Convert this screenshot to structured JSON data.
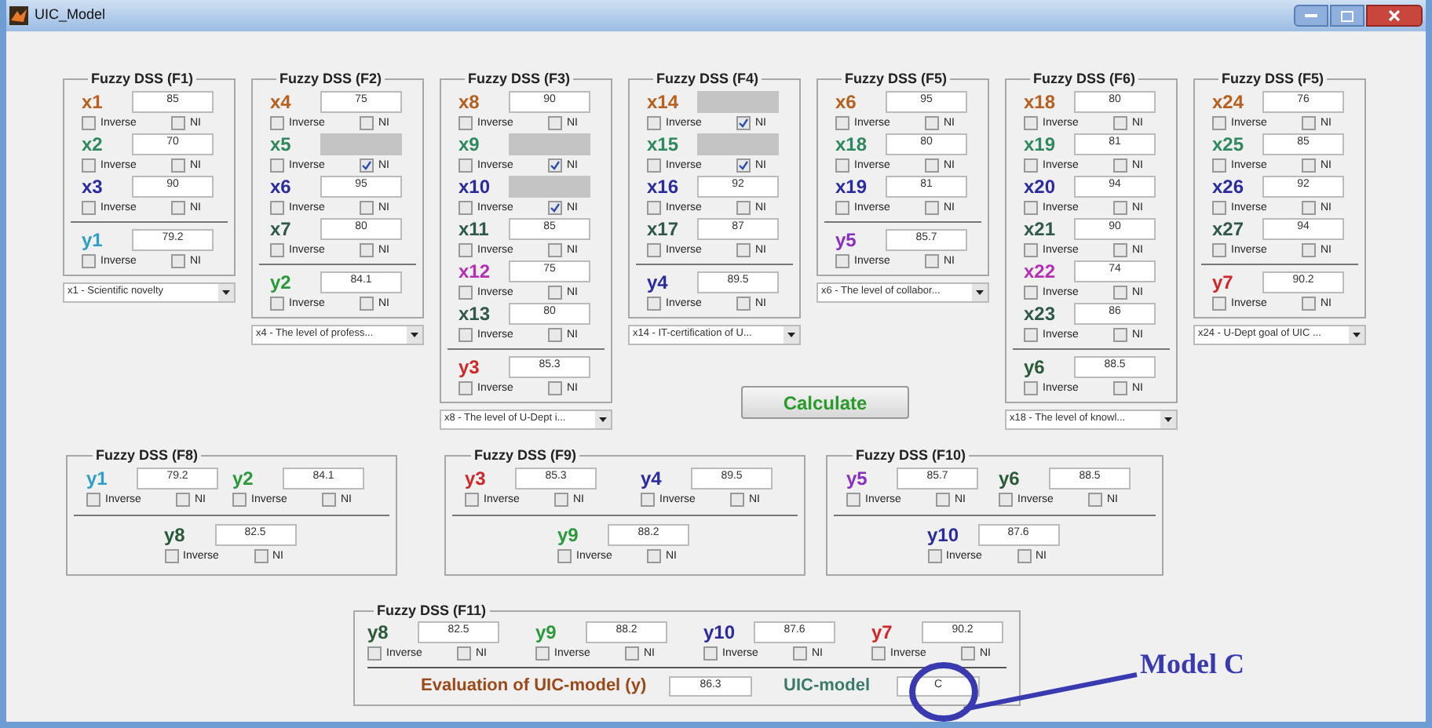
{
  "window": {
    "title": "UIC_Model"
  },
  "top_panels": [
    {
      "title": "Fuzzy DSS (F1)",
      "inputs": [
        {
          "name": "x1",
          "color": "#b5601e",
          "value": "85",
          "disabled": false,
          "inverse_label": "Inverse",
          "inverse": false,
          "ni_label": "NI",
          "ni": false
        },
        {
          "name": "x2",
          "color": "#2e8a5e",
          "value": "70",
          "disabled": false,
          "inverse_label": "Inverse",
          "inverse": false,
          "ni_label": "NI",
          "ni": false
        },
        {
          "name": "x3",
          "color": "#2b2ba0",
          "value": "90",
          "disabled": false,
          "inverse_label": "Inverse",
          "inverse": false,
          "ni_label": "NI",
          "ni": false
        }
      ],
      "output": {
        "name": "y1",
        "color": "#2f9fc8",
        "value": "79.2",
        "disabled": false,
        "inverse_label": "Inverse",
        "inverse": false,
        "ni_label": "NI",
        "ni": false
      },
      "dropdown": "x1 - Scientific novelty"
    },
    {
      "title": "Fuzzy DSS (F2)",
      "inputs": [
        {
          "name": "x4",
          "color": "#b5601e",
          "value": "75",
          "disabled": false,
          "inverse_label": "Inverse",
          "inverse": false,
          "ni_label": "NI",
          "ni": false
        },
        {
          "name": "x5",
          "color": "#2e8a5e",
          "disabled": true,
          "inverse_label": "Inverse",
          "inverse": false,
          "ni_label": "NI",
          "ni": true
        },
        {
          "name": "x6",
          "color": "#2b2ba0",
          "value": "95",
          "disabled": false,
          "inverse_label": "Inverse",
          "inverse": false,
          "ni_label": "NI",
          "ni": false
        },
        {
          "name": "x7",
          "color": "#2f5a4a",
          "value": "80",
          "disabled": false,
          "inverse_label": "Inverse",
          "inverse": false,
          "ni_label": "NI",
          "ni": false
        }
      ],
      "output": {
        "name": "y2",
        "color": "#2a9a3a",
        "value": "84.1",
        "disabled": false,
        "inverse_label": "Inverse",
        "inverse": false,
        "ni_label": "NI",
        "ni": false
      },
      "dropdown": "x4 - The level of profess..."
    },
    {
      "title": "Fuzzy DSS (F3)",
      "inputs": [
        {
          "name": "x8",
          "color": "#b5601e",
          "value": "90",
          "disabled": false,
          "inverse_label": "Inverse",
          "inverse": false,
          "ni_label": "NI",
          "ni": false
        },
        {
          "name": "x9",
          "color": "#2e8a5e",
          "disabled": true,
          "inverse_label": "Inverse",
          "inverse": false,
          "ni_label": "NI",
          "ni": true
        },
        {
          "name": "x10",
          "color": "#2b2ba0",
          "disabled": true,
          "inverse_label": "Inverse",
          "inverse": false,
          "ni_label": "NI",
          "ni": true
        },
        {
          "name": "x11",
          "color": "#2f5a4a",
          "value": "85",
          "disabled": false,
          "inverse_label": "Inverse",
          "inverse": false,
          "ni_label": "NI",
          "ni": false
        },
        {
          "name": "x12",
          "color": "#b52fb5",
          "value": "75",
          "disabled": false,
          "inverse_label": "Inverse",
          "inverse": false,
          "ni_label": "NI",
          "ni": false
        },
        {
          "name": "x13",
          "color": "#2f5a4a",
          "value": "80",
          "disabled": false,
          "inverse_label": "Inverse",
          "inverse": false,
          "ni_label": "NI",
          "ni": false
        }
      ],
      "output": {
        "name": "y3",
        "color": "#d02828",
        "value": "85.3",
        "disabled": false,
        "inverse_label": "Inverse",
        "inverse": false,
        "ni_label": "NI",
        "ni": false
      },
      "dropdown": "x8 - The level of U-Dept i..."
    },
    {
      "title": "Fuzzy DSS (F4)",
      "inputs": [
        {
          "name": "x14",
          "color": "#b5601e",
          "disabled": true,
          "inverse_label": "Inverse",
          "inverse": false,
          "ni_label": "NI",
          "ni": true
        },
        {
          "name": "x15",
          "color": "#2e8a5e",
          "disabled": true,
          "inverse_label": "Inverse",
          "inverse": false,
          "ni_label": "NI",
          "ni": true
        },
        {
          "name": "x16",
          "color": "#2b2ba0",
          "value": "92",
          "disabled": false,
          "inverse_label": "Inverse",
          "inverse": false,
          "ni_label": "NI",
          "ni": false
        },
        {
          "name": "x17",
          "color": "#2f5a4a",
          "value": "87",
          "disabled": false,
          "inverse_label": "Inverse",
          "inverse": false,
          "ni_label": "NI",
          "ni": false
        }
      ],
      "output": {
        "name": "y4",
        "color": "#2b2ba0",
        "value": "89.5",
        "disabled": false,
        "inverse_label": "Inverse",
        "inverse": false,
        "ni_label": "NI",
        "ni": false
      },
      "dropdown": "x14 - IT-certification of U..."
    },
    {
      "title": "Fuzzy DSS (F5)",
      "inputs": [
        {
          "name": "x6",
          "color": "#b5601e",
          "value": "95",
          "disabled": false,
          "inverse_label": "Inverse",
          "inverse": false,
          "ni_label": "NI",
          "ni": false
        },
        {
          "name": "x18",
          "color": "#2e8a5e",
          "value": "80",
          "disabled": false,
          "inverse_label": "Inverse",
          "inverse": false,
          "ni_label": "NI",
          "ni": false
        },
        {
          "name": "x19",
          "color": "#2b2ba0",
          "value": "81",
          "disabled": false,
          "inverse_label": "Inverse",
          "inverse": false,
          "ni_label": "NI",
          "ni": false
        }
      ],
      "output": {
        "name": "y5",
        "color": "#8a2fc0",
        "value": "85.7",
        "disabled": false,
        "inverse_label": "Inverse",
        "inverse": false,
        "ni_label": "NI",
        "ni": false
      },
      "dropdown": "x6 - The level of collabor..."
    },
    {
      "title": "Fuzzy DSS (F6)",
      "inputs": [
        {
          "name": "x18",
          "color": "#b5601e",
          "value": "80",
          "disabled": false,
          "inverse_label": "Inverse",
          "inverse": false,
          "ni_label": "NI",
          "ni": false
        },
        {
          "name": "x19",
          "color": "#2e8a5e",
          "value": "81",
          "disabled": false,
          "inverse_label": "Inverse",
          "inverse": false,
          "ni_label": "NI",
          "ni": false
        },
        {
          "name": "x20",
          "color": "#2b2ba0",
          "value": "94",
          "disabled": false,
          "inverse_label": "Inverse",
          "inverse": false,
          "ni_label": "NI",
          "ni": false
        },
        {
          "name": "x21",
          "color": "#2f5a4a",
          "value": "90",
          "disabled": false,
          "inverse_label": "Inverse",
          "inverse": false,
          "ni_label": "NI",
          "ni": false
        },
        {
          "name": "x22",
          "color": "#b52fb5",
          "value": "74",
          "disabled": false,
          "inverse_label": "Inverse",
          "inverse": false,
          "ni_label": "NI",
          "ni": false
        },
        {
          "name": "x23",
          "color": "#2f5a4a",
          "value": "86",
          "disabled": false,
          "inverse_label": "Inverse",
          "inverse": false,
          "ni_label": "NI",
          "ni": false
        }
      ],
      "output": {
        "name": "y6",
        "color": "#2a5a3a",
        "value": "88.5",
        "disabled": false,
        "inverse_label": "Inverse",
        "inverse": false,
        "ni_label": "NI",
        "ni": false
      },
      "dropdown": "x18 - The level of knowl..."
    },
    {
      "title": "Fuzzy DSS (F5)",
      "inputs": [
        {
          "name": "x24",
          "color": "#b5601e",
          "value": "76",
          "disabled": false,
          "inverse_label": "Inverse",
          "inverse": false,
          "ni_label": "NI",
          "ni": false
        },
        {
          "name": "x25",
          "color": "#2e8a5e",
          "value": "85",
          "disabled": false,
          "inverse_label": "Inverse",
          "inverse": false,
          "ni_label": "NI",
          "ni": false
        },
        {
          "name": "x26",
          "color": "#2b2ba0",
          "value": "92",
          "disabled": false,
          "inverse_label": "Inverse",
          "inverse": false,
          "ni_label": "NI",
          "ni": false
        },
        {
          "name": "x27",
          "color": "#2f5a4a",
          "value": "94",
          "disabled": false,
          "inverse_label": "Inverse",
          "inverse": false,
          "ni_label": "NI",
          "ni": false
        }
      ],
      "output": {
        "name": "y7",
        "color": "#d02828",
        "value": "90.2",
        "disabled": false,
        "inverse_label": "Inverse",
        "inverse": false,
        "ni_label": "NI",
        "ni": false
      },
      "dropdown": "x24 - U-Dept goal of UIC ..."
    }
  ],
  "calculate_button": "Calculate",
  "bottom_panels": [
    {
      "title": "Fuzzy DSS (F8)",
      "inputs": [
        {
          "name": "y1",
          "color": "#2f9fc8",
          "value": "79.2",
          "disabled": false,
          "inverse_label": "Inverse",
          "inverse": false,
          "ni_label": "NI",
          "ni": false
        },
        {
          "name": "y2",
          "color": "#2a9a3a",
          "value": "84.1",
          "disabled": false,
          "inverse_label": "Inverse",
          "inverse": false,
          "ni_label": "NI",
          "ni": false
        }
      ],
      "output": {
        "name": "y8",
        "color": "#2a5a3a",
        "value": "82.5",
        "disabled": false,
        "inverse_label": "Inverse",
        "inverse": false,
        "ni_label": "NI",
        "ni": false
      }
    },
    {
      "title": "Fuzzy DSS (F9)",
      "inputs": [
        {
          "name": "y3",
          "color": "#d02828",
          "value": "85.3",
          "disabled": false,
          "inverse_label": "Inverse",
          "inverse": false,
          "ni_label": "NI",
          "ni": false
        },
        {
          "name": "y4",
          "color": "#2b2ba0",
          "value": "89.5",
          "disabled": false,
          "inverse_label": "Inverse",
          "inverse": false,
          "ni_label": "NI",
          "ni": false
        }
      ],
      "output": {
        "name": "y9",
        "color": "#2a9a3a",
        "value": "88.2",
        "disabled": false,
        "inverse_label": "Inverse",
        "inverse": false,
        "ni_label": "NI",
        "ni": false
      }
    },
    {
      "title": "Fuzzy DSS (F10)",
      "inputs": [
        {
          "name": "y5",
          "color": "#8a2fc0",
          "value": "85.7",
          "disabled": false,
          "inverse_label": "Inverse",
          "inverse": false,
          "ni_label": "NI",
          "ni": false
        },
        {
          "name": "y6",
          "color": "#2a5a3a",
          "value": "88.5",
          "disabled": false,
          "inverse_label": "Inverse",
          "inverse": false,
          "ni_label": "NI",
          "ni": false
        }
      ],
      "output": {
        "name": "y10",
        "color": "#2b2ba0",
        "value": "87.6",
        "disabled": false,
        "inverse_label": "Inverse",
        "inverse": false,
        "ni_label": "NI",
        "ni": false
      }
    }
  ],
  "final_panel": {
    "title": "Fuzzy DSS (F11)",
    "inputs": [
      {
        "name": "y8",
        "color": "#2a5a3a",
        "value": "82.5",
        "disabled": false,
        "inverse_label": "Inverse",
        "inverse": false,
        "ni_label": "NI",
        "ni": false
      },
      {
        "name": "y9",
        "color": "#2a9a3a",
        "value": "88.2",
        "disabled": false,
        "inverse_label": "Inverse",
        "inverse": false,
        "ni_label": "NI",
        "ni": false
      },
      {
        "name": "y10",
        "color": "#2b2ba0",
        "value": "87.6",
        "disabled": false,
        "inverse_label": "Inverse",
        "inverse": false,
        "ni_label": "NI",
        "ni": false
      },
      {
        "name": "y7",
        "color": "#d02828",
        "value": "90.2",
        "disabled": false,
        "inverse_label": "Inverse",
        "inverse": false,
        "ni_label": "NI",
        "ni": false
      }
    ],
    "evaluation_label": "Evaluation of UIC-model (y)",
    "evaluation_value": "86.3",
    "model_label": "UIC-model",
    "model_value": "C"
  },
  "annotation": {
    "label": "Model C"
  }
}
